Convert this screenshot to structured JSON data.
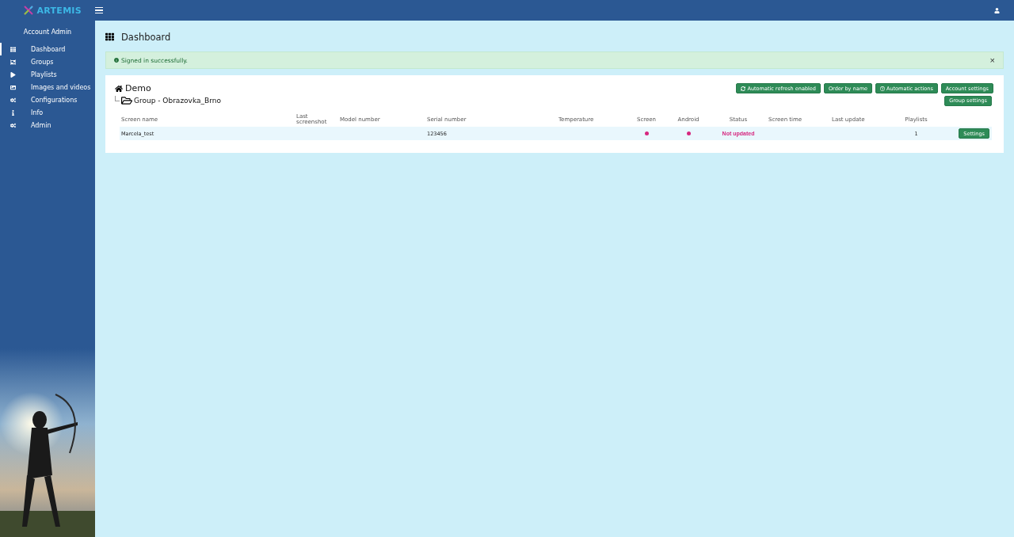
{
  "header": {
    "logo": "ARTEMIS"
  },
  "sidebar": {
    "user": "Account Admin",
    "items": [
      {
        "label": "Dashboard",
        "selected": true
      },
      {
        "label": "Groups",
        "selected": false
      },
      {
        "label": "Playlists",
        "selected": false
      },
      {
        "label": "Images and videos",
        "selected": false
      },
      {
        "label": "Configurations",
        "selected": false
      },
      {
        "label": "Info",
        "selected": false
      },
      {
        "label": "Admin",
        "selected": false
      }
    ]
  },
  "page": {
    "title": "Dashboard"
  },
  "alert": {
    "message": "Signed in successfully.",
    "close": "×"
  },
  "account": {
    "name": "Demo",
    "buttons": [
      "Automatic refresh enabled",
      "Order by name",
      "Automatic actions",
      "Account settings"
    ]
  },
  "group": {
    "name": "Group - Obrazovka_Brno",
    "settings_button": "Group settings",
    "table": {
      "columns": [
        "Screen name",
        "Last screenshot",
        "Model number",
        "Serial number",
        "Temperature",
        "Screen",
        "Android",
        "Status",
        "Screen time",
        "Last update",
        "Playlists"
      ],
      "rows": [
        {
          "screen_name": "Marcela_test",
          "serial_number": "123456",
          "screen": {
            "color": "#d6287f"
          },
          "android": {
            "color": "#d6287f"
          },
          "status": {
            "text": "Not updated",
            "color": "#d6287f"
          },
          "playlists": "1",
          "button": "Settings"
        }
      ]
    }
  }
}
